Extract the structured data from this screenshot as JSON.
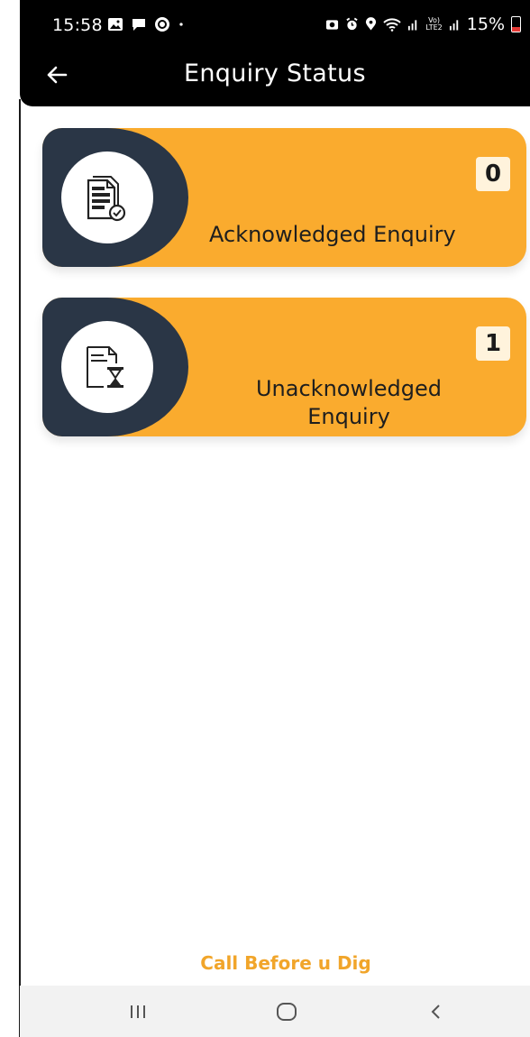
{
  "status_bar": {
    "time": "15:58",
    "battery_percent": "15%",
    "network_label_top": "Vo)",
    "network_label_bottom": "LTE2",
    "icons": [
      "gallery-icon",
      "message-icon",
      "app-icon",
      "dot-icon",
      "camera-icon",
      "alarm-icon",
      "location-icon",
      "wifi-icon",
      "signal-icon",
      "battery-icon"
    ]
  },
  "header": {
    "title": "Enquiry Status",
    "back_icon": "arrow-left-icon"
  },
  "cards": [
    {
      "count": "0",
      "label": "Acknowledged Enquiry",
      "icon": "document-check-icon"
    },
    {
      "count": "1",
      "label": "Unacknowledged Enquiry",
      "icon": "document-hourglass-icon"
    }
  ],
  "footer": {
    "text": "Call Before u Dig"
  },
  "nav": {
    "recent_icon": "recent-apps-icon",
    "home_icon": "home-icon",
    "back_icon": "back-chevron-icon"
  },
  "colors": {
    "card_bg": "#FAAB2E",
    "card_dark": "#2A3646",
    "header_bg": "#000000",
    "footer_text": "#F1A52A",
    "badge_bg": "#FFF3DC"
  }
}
